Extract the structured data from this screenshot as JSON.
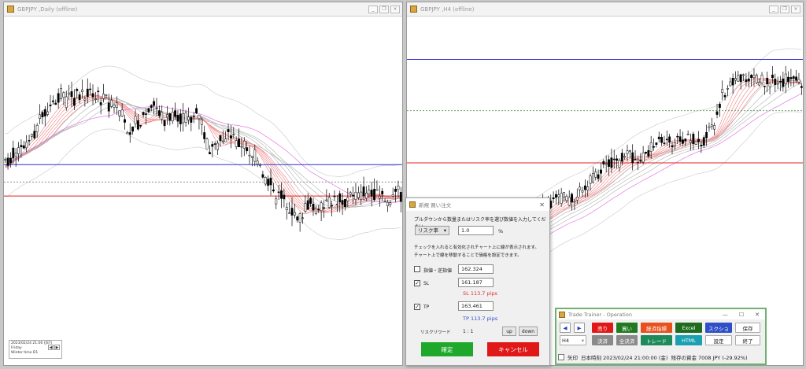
{
  "left_window": {
    "title": "GBPJPY ,Daily (offline)",
    "info": [
      "2023/02/24 21:00 (JST)",
      "Friday",
      "Winter time     D1"
    ]
  },
  "right_window": {
    "title": "GBPJPY ,H4 (offline)"
  },
  "order_dialog": {
    "title": "新規 買い注文",
    "instruction": "プルダウンから数量またはリスク率を選び数値を入力してください。",
    "mode_select": "リスク率",
    "amount_value": "1.0",
    "amount_unit": "%",
    "note1": "チェックを入れると有効化されチャート上に線が表示されます。",
    "note2": "チャート上で線を移動することで価格を設定できます。",
    "limit_label": "指値・逆指値",
    "limit_value": "162.324",
    "limit_checked": false,
    "sl_label": "SL",
    "sl_value": "161.187",
    "sl_checked": true,
    "sl_pips": "SL 113.7 pips",
    "tp_label": "TP",
    "tp_value": "163.461",
    "tp_checked": true,
    "tp_pips": "TP 113.7 pips",
    "rr_label": "リスクリワード",
    "rr_value": "1 : 1",
    "up_label": "up",
    "down_label": "down",
    "confirm_label": "確定",
    "cancel_label": "キャンセル",
    "colors": {
      "confirm": "#1fa82a",
      "cancel": "#e01818",
      "sl_text": "#e03030",
      "tp_text": "#3050d0"
    }
  },
  "trade_trainer": {
    "title": "Trade Trainer - Operation",
    "prev_icon": "◀",
    "next_icon": "▶",
    "timeframe": "H4",
    "buttons_row1": {
      "sell": "売り",
      "buy": "買い",
      "indicators": "経済指標",
      "excel": "Excel",
      "screenshot": "スクショ",
      "save": "保存"
    },
    "buttons_row2": {
      "settle": "決済",
      "settle_all": "全決済",
      "trade": "トレード",
      "html": "HTML",
      "settings": "設定",
      "exit": "終了"
    },
    "arrow_label": "矢印",
    "status_text": "日本時刻 2023/02/24 21:00:00 (金)",
    "funds_text": "残存の資金 7008 JPY (-29.92%)"
  }
}
